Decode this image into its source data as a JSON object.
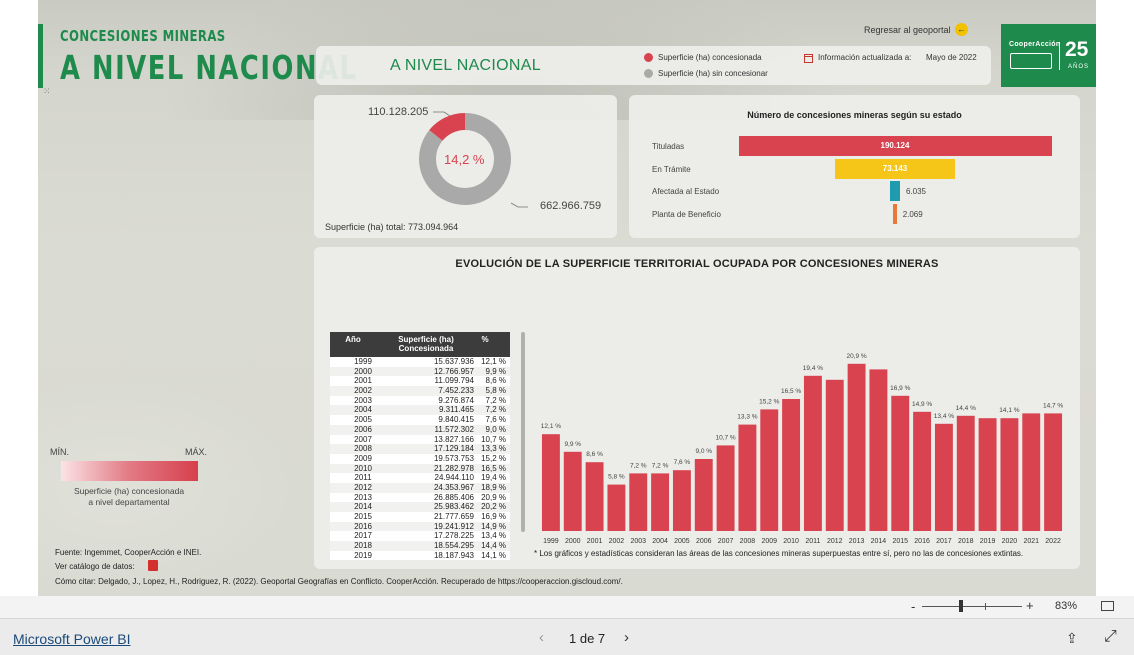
{
  "header": {
    "title_small": "CONCESIONES MINERAS",
    "title_big": "A NIVEL NACIONAL",
    "back_link": "Regresar al geoportal",
    "logo_brand": "CooperAcción",
    "logo_years": "25",
    "logo_years_label": "AÑOS"
  },
  "top_panel": {
    "subtitle": "A NIVEL NACIONAL",
    "legend": [
      {
        "label": "Superficie (ha) concesionada",
        "color": "#d8434f"
      },
      {
        "label": "Superficie (ha) sin concesionar",
        "color": "#a9a9a9"
      }
    ],
    "updated_label": "Información actualizada a:",
    "updated_value": "Mayo de 2022"
  },
  "donut": {
    "concesionada": "110.128.205",
    "sin_concesionar": "662.966.759",
    "percent_label": "14,2 %",
    "percent_value": 14.2,
    "total_label": "Superficie (ha) total: 773.094.964",
    "colors": {
      "concesionada": "#d8434f",
      "sin_concesionar": "#a9a9a9"
    }
  },
  "estado": {
    "title": "Número de concesiones mineras según su estado",
    "items": [
      {
        "label": "Tituladas",
        "value": 190124,
        "value_label": "190.124",
        "color": "#d8434f"
      },
      {
        "label": "En Trámite",
        "value": 73143,
        "value_label": "73.143",
        "color": "#f5c518"
      },
      {
        "label": "Afectada al Estado",
        "value": 6035,
        "value_label": "6.035",
        "color": "#1f9bb0"
      },
      {
        "label": "Planta de Beneficio",
        "value": 2069,
        "value_label": "2.069",
        "color": "#e8793a"
      }
    ]
  },
  "evolucion": {
    "title": "EVOLUCIÓN DE LA SUPERFICIE TERRITORIAL OCUPADA POR CONCESIONES MINERAS",
    "table_headers": {
      "anio": "Año",
      "superficie": "Superficie (ha) Concesionada",
      "pct": "%"
    },
    "rows": [
      [
        "1999",
        "15.637.936",
        "12,1 %"
      ],
      [
        "2000",
        "12.766.957",
        "9,9 %"
      ],
      [
        "2001",
        "11.099.794",
        "8,6 %"
      ],
      [
        "2002",
        "7.452.233",
        "5,8 %"
      ],
      [
        "2003",
        "9.276.874",
        "7,2 %"
      ],
      [
        "2004",
        "9.311.465",
        "7,2 %"
      ],
      [
        "2005",
        "9.840.415",
        "7,6 %"
      ],
      [
        "2006",
        "11.572.302",
        "9,0 %"
      ],
      [
        "2007",
        "13.827.166",
        "10,7 %"
      ],
      [
        "2008",
        "17.129.184",
        "13,3 %"
      ],
      [
        "2009",
        "19.573.753",
        "15,2 %"
      ],
      [
        "2010",
        "21.282.978",
        "16,5 %"
      ],
      [
        "2011",
        "24.944.110",
        "19,4 %"
      ],
      [
        "2012",
        "24.353.967",
        "18,9 %"
      ],
      [
        "2013",
        "26.885.406",
        "20,9 %"
      ],
      [
        "2014",
        "25.983.462",
        "20,2 %"
      ],
      [
        "2015",
        "21.777.659",
        "16,9 %"
      ],
      [
        "2016",
        "19.241.912",
        "14,9 %"
      ],
      [
        "2017",
        "17.278.225",
        "13,4 %"
      ],
      [
        "2018",
        "18.554.295",
        "14,4 %"
      ],
      [
        "2019",
        "18.187.943",
        "14,1 %"
      ]
    ],
    "footnote": "* Los gráficos y estadísticas consideran las áreas de las concesiones mineras superpuestas entre sí, pero no las de concesiones extintas."
  },
  "chart_data": {
    "type": "bar",
    "categories": [
      "1999",
      "2000",
      "2001",
      "2002",
      "2003",
      "2004",
      "2005",
      "2006",
      "2007",
      "2008",
      "2009",
      "2010",
      "2011",
      "2012",
      "2013",
      "2014",
      "2015",
      "2016",
      "2017",
      "2018",
      "2019",
      "2020",
      "2021",
      "2022"
    ],
    "values": [
      12.1,
      9.9,
      8.6,
      5.8,
      7.2,
      7.2,
      7.6,
      9.0,
      10.7,
      13.3,
      15.2,
      16.5,
      19.4,
      18.9,
      20.9,
      20.2,
      16.9,
      14.9,
      13.4,
      14.4,
      14.1,
      14.1,
      14.7,
      14.7
    ],
    "data_labels": [
      "12,1 %",
      "9,9 %",
      "8,6 %",
      "5,8 %",
      "7,2 %",
      "7,2 %",
      "7,6 %",
      "9,0 %",
      "10,7 %",
      "13,3 %",
      "15,2 %",
      "16,5 %",
      "19,4 %",
      "",
      "20,9 %",
      "",
      "16,9 %",
      "14,9 %",
      "13,4 %",
      "14,4 %",
      "",
      "14,1 %",
      "",
      "14,7 %"
    ],
    "ylim": [
      0,
      21
    ],
    "color": "#d8434f",
    "title": "",
    "xlabel": "",
    "ylabel": ""
  },
  "left": {
    "scale_min": "MÍN.",
    "scale_max": "MÁX.",
    "scale_caption_1": "Superficie (ha) concesionada",
    "scale_caption_2": "a nivel departamental",
    "source": "Fuente: Ingemmet, CooperAcción e INEI.",
    "catalog": "Ver catálogo de datos:",
    "citation": "Cómo citar: Delgado, J., Lopez, H., Rodriguez, R. (2022). Geoportal Geografías en Conflicto. CooperAcción. Recuperado de https://cooperaccion.giscloud.com/."
  },
  "viewer": {
    "zoom_minus": "-",
    "zoom_plus": "+",
    "zoom": "83%",
    "brand": "Microsoft Power BI",
    "page": "1 de 7",
    "prev": "‹",
    "next": "›"
  }
}
